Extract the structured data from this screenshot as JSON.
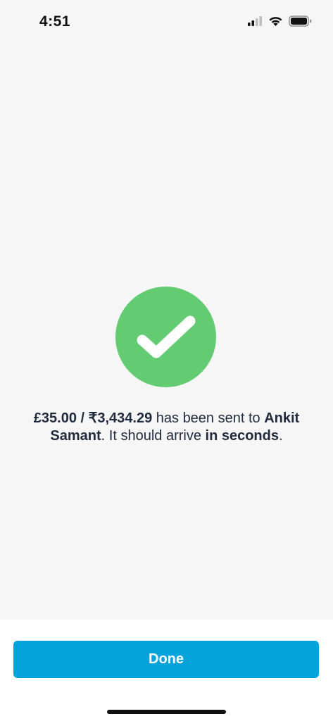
{
  "status_bar": {
    "time": "4:51",
    "icons": [
      "cellular-signal-icon",
      "wifi-icon",
      "battery-icon"
    ]
  },
  "confirmation": {
    "icon": "checkmark-icon",
    "icon_color": "#63cb72",
    "amount": "£35.00 / ₹3,434.29",
    "sent_text": " has been sent to ",
    "recipient": "Ankit Samant",
    "arrive_text": ". It should arrive ",
    "timing": "in seconds",
    "end_text": "."
  },
  "actions": {
    "done_label": "Done",
    "done_color": "#04a3dc"
  }
}
